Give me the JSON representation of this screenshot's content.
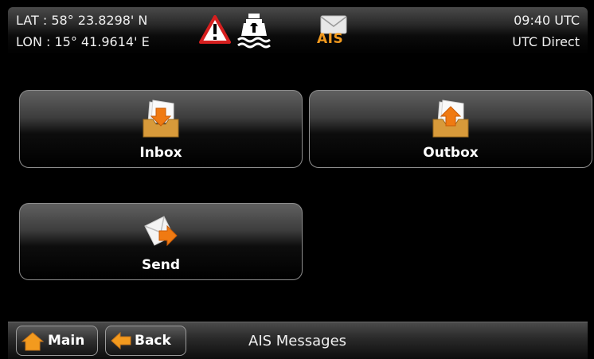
{
  "status": {
    "lat": "LAT : 58° 23.8298' N",
    "lon": "LON : 15° 41.9614' E",
    "time": "09:40 UTC",
    "time_source": "UTC Direct",
    "ais_label": "AIS",
    "accent": "#f39a1e",
    "warning_color": "#d61f1f"
  },
  "menu": {
    "inbox_label": "Inbox",
    "outbox_label": "Outbox",
    "send_label": "Send"
  },
  "footer": {
    "main_label": "Main",
    "back_label": "Back",
    "title": "AIS Messages"
  },
  "icons": {
    "warning": "warning-triangle-icon",
    "ship": "ship-icon",
    "ais": "envelope-icon",
    "inbox": "inbox-tray-icon",
    "outbox": "outbox-tray-icon",
    "send": "send-envelope-icon",
    "main": "home-icon",
    "back": "back-arrow-icon"
  }
}
